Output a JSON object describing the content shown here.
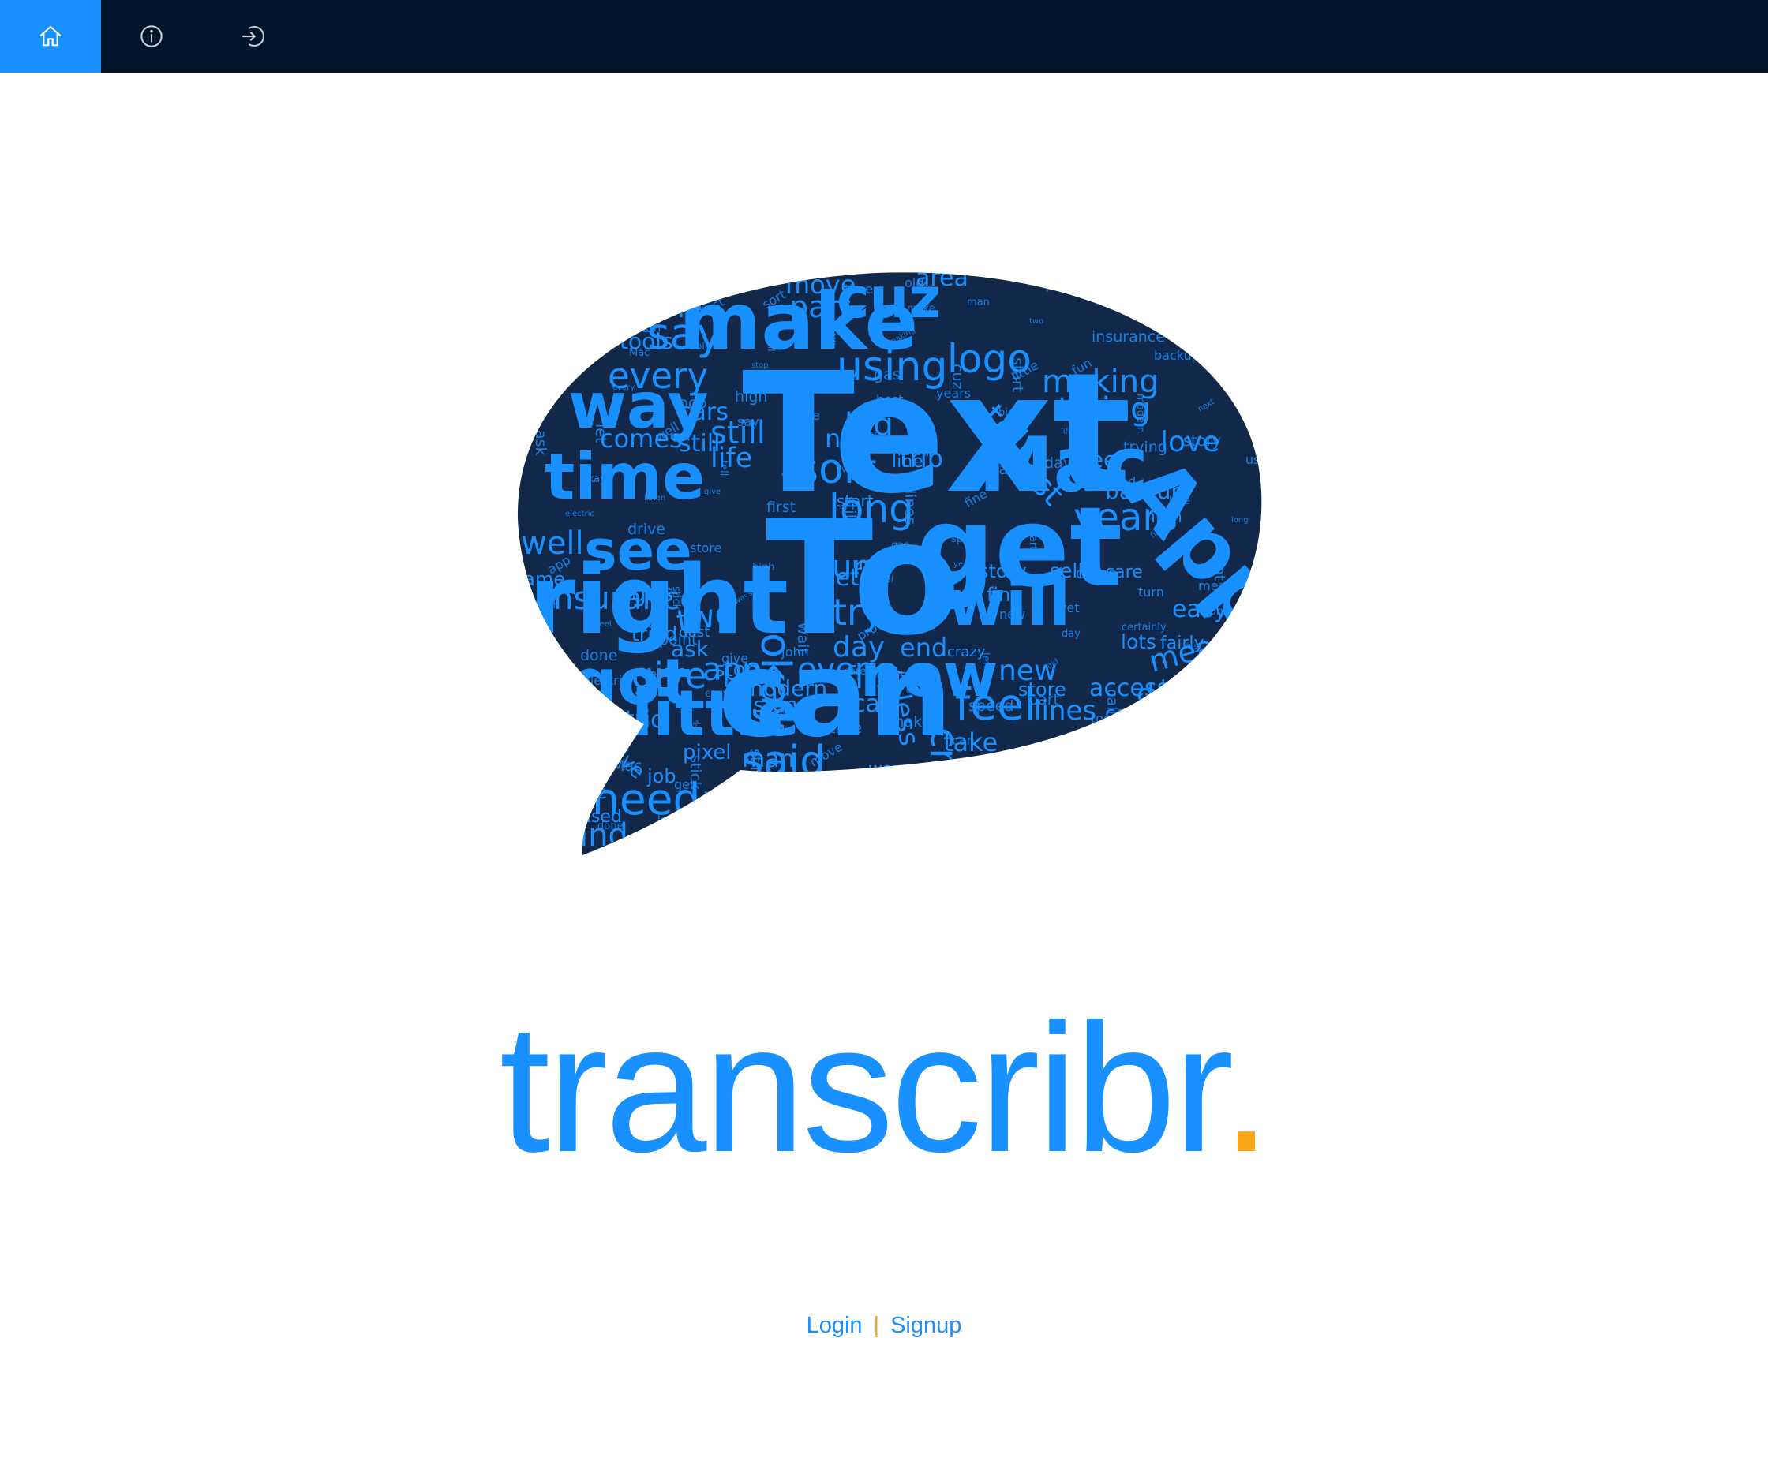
{
  "nav": {
    "items": [
      {
        "icon": "home-icon",
        "active": true
      },
      {
        "icon": "info-circle-icon",
        "active": false
      },
      {
        "icon": "login-icon",
        "active": false
      }
    ]
  },
  "hero": {
    "image_alt": "word cloud speech bubble",
    "cloud_words": [
      "Text",
      "To",
      "can",
      "right",
      "get",
      "make",
      "Apple",
      "Mac",
      "time",
      "way",
      "see",
      "will",
      "little",
      "now",
      "say",
      "cuz",
      "using",
      "logo",
      "making",
      "trying",
      "every",
      "still",
      "life",
      "nice",
      "sort",
      "big",
      "long",
      "tell",
      "years",
      "love",
      "well",
      "gas",
      "tried",
      "let",
      "try",
      "day",
      "app",
      "first",
      "new",
      "got",
      "give",
      "need",
      "find",
      "point",
      "pixel",
      "call",
      "feel",
      "take",
      "said",
      "ever",
      "data",
      "left",
      "mean",
      "easy",
      "lots",
      "fairly",
      "sell",
      "comes",
      "tools",
      "done",
      "move",
      "part",
      "area",
      "still",
      "cars",
      "trip",
      "last",
      "free",
      "backup",
      "used",
      "best",
      "insurance",
      "cruise",
      "end",
      "two",
      "ask",
      "stop",
      "man",
      "next",
      "able",
      "old",
      "modern",
      "listen",
      "less",
      "fun",
      "okay",
      "line",
      "start",
      "use",
      "high",
      "fine",
      "story",
      "store",
      "lines",
      "turn",
      "drive",
      "pro",
      "came",
      "electric",
      "wait",
      "side",
      "job",
      "ways",
      "speed",
      "dust",
      "stick",
      "crazy",
      "certainly",
      "access",
      "care",
      "yet",
      "sorry",
      "John",
      "Center"
    ]
  },
  "brand": {
    "name": "transcribr",
    "dot": "."
  },
  "auth": {
    "login": "Login",
    "separator": "|",
    "signup": "Signup"
  },
  "colors": {
    "navbar": "#001529",
    "accent": "#1890ff",
    "dot": "#faa519",
    "cloud_dark": "#000000"
  }
}
